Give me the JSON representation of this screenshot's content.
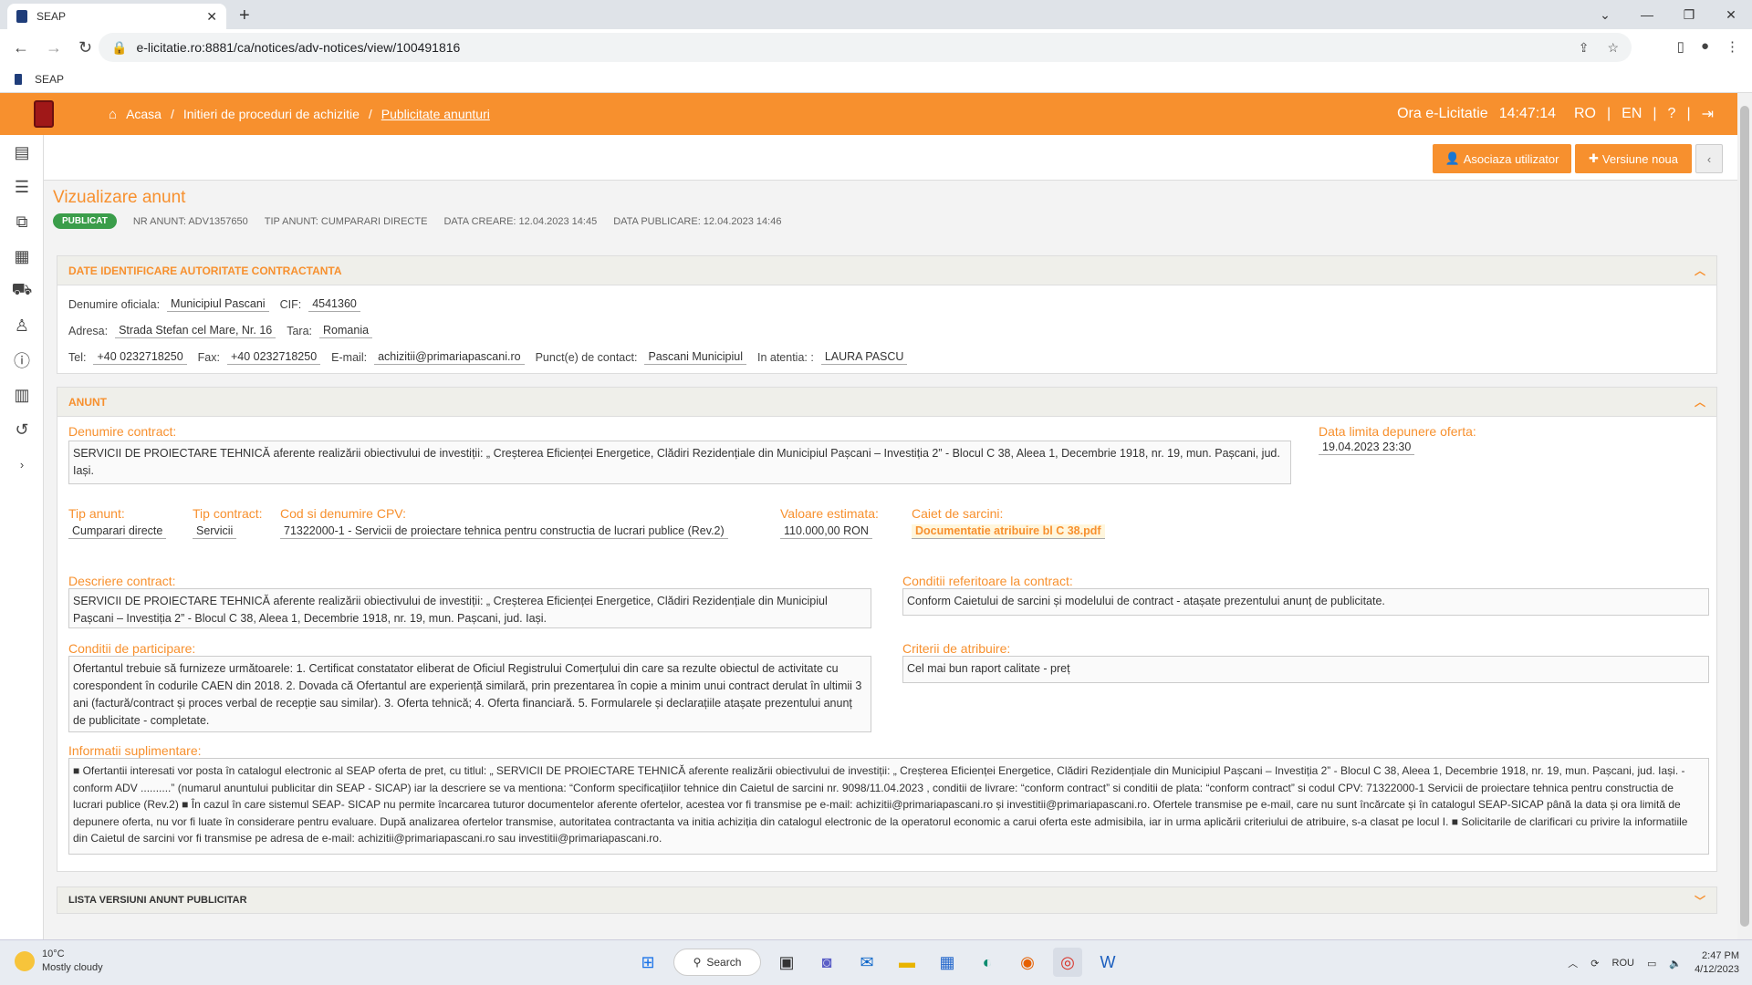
{
  "browser": {
    "tab_title": "SEAP",
    "url": "e-licitatie.ro:8881/ca/notices/adv-notices/view/100491816",
    "bookmark": "SEAP"
  },
  "header": {
    "crumbs": [
      "Acasa",
      "Initieri de proceduri de achizitie",
      "Publicitate anunturi"
    ],
    "time_label": "Ora e-Licitatie",
    "time": "14:47:14",
    "lang_ro": "RO",
    "lang_en": "EN"
  },
  "toolbar": {
    "assoc_label": "Asociaza utilizator",
    "new_version_label": "Versiune noua",
    "collapse_label": "‹"
  },
  "page": {
    "title": "Vizualizare anunt",
    "status": "PUBLICAT",
    "nr_anunt": "NR ANUNT: ADV1357650",
    "tip_anunt": "TIP ANUNT: CUMPARARI DIRECTE",
    "data_creare": "DATA CREARE: 12.04.2023 14:45",
    "data_publicare": "DATA PUBLICARE: 12.04.2023 14:46"
  },
  "authority": {
    "heading": "DATE IDENTIFICARE AUTORITATE CONTRACTANTA",
    "denumire_lbl": "Denumire oficiala:",
    "denumire": "Municipiul Pascani",
    "cif_lbl": "CIF:",
    "cif": "4541360",
    "adresa_lbl": "Adresa:",
    "adresa": "Strada Stefan cel Mare, Nr. 16",
    "tara_lbl": "Tara:",
    "tara": "Romania",
    "tel_lbl": "Tel:",
    "tel": "+40 0232718250",
    "fax_lbl": "Fax:",
    "fax": "+40 0232718250",
    "email_lbl": "E-mail:",
    "email": "achizitii@primariapascani.ro",
    "contact_lbl": "Punct(e) de contact:",
    "contact": "Pascani Municipiul",
    "atentia_lbl": "In atentia: :",
    "atentia": "LAURA PASCU"
  },
  "anunt": {
    "heading": "ANUNT",
    "denumire_lbl": "Denumire contract:",
    "denumire": "SERVICII DE PROIECTARE TEHNICĂ aferente realizării obiectivului de investiții: „ Creșterea Eficienței Energetice, Clădiri Rezidențiale din Municipiul Pașcani – Investiția 2” - Blocul C 38, Aleea 1, Decembrie 1918, nr. 19, mun. Pașcani, jud. Iași.",
    "data_limita_lbl": "Data limita depunere oferta:",
    "data_limita": "19.04.2023 23:30",
    "tip_anunt_lbl": "Tip anunt:",
    "tip_anunt": "Cumparari directe",
    "tip_contract_lbl": "Tip contract:",
    "tip_contract": "Servicii",
    "cpv_lbl": "Cod si denumire CPV:",
    "cpv": "71322000-1 - Servicii de proiectare tehnica pentru constructia de lucrari publice (Rev.2)",
    "valoare_lbl": "Valoare estimata:",
    "valoare": "110.000,00  RON",
    "caiet_lbl": "Caiet de sarcini:",
    "caiet": "Documentatie atribuire bl C 38.pdf",
    "descriere_lbl": "Descriere contract:",
    "descriere": "SERVICII DE PROIECTARE TEHNICĂ aferente realizării obiectivului de investiții: „ Creșterea Eficienței Energetice, Clădiri Rezidențiale din Municipiul Pașcani – Investiția 2” - Blocul C 38, Aleea 1, Decembrie 1918, nr. 19, mun. Pașcani, jud. Iași.",
    "conditii_contract_lbl": "Conditii referitoare la contract:",
    "conditii_contract": "Conform Caietului de sarcini și modelului de contract - atașate prezentului anunț de publicitate.",
    "conditii_part_lbl": "Conditii de participare:",
    "conditii_part": "Ofertantul trebuie să furnizeze următoarele: 1. Certificat constatator eliberat de Oficiul Registrului Comerțului din care sa rezulte obiectul de activitate cu corespondent în codurile CAEN din 2018. 2. Dovada că Ofertantul are experiență similară, prin prezentarea în copie a minim unui contract derulat în ultimii 3 ani (factură/contract și proces verbal de recepție sau similar). 3. Oferta tehnică; 4. Oferta financiară. 5. Formularele și declarațiile atașate prezentului anunț de publicitate - completate.",
    "criterii_lbl": "Criterii de atribuire:",
    "criterii": "Cel mai bun raport calitate - preț",
    "info_lbl": "Informatii suplimentare:",
    "info": "■ Ofertantii interesati vor posta în catalogul electronic al SEAP oferta de pret, cu titlul: „ SERVICII DE PROIECTARE TEHNICĂ aferente realizării obiectivului de investiții: „ Creșterea Eficienței Energetice, Clădiri Rezidențiale din Municipiul Pașcani – Investiția 2” - Blocul C 38, Aleea 1, Decembrie 1918, nr. 19, mun. Pașcani, jud. Iași. - conform ADV ..........” (numarul anuntului publicitar din SEAP - SICAP) iar la descriere se va mentiona: “Conform specificațiilor tehnice din Caietul de sarcini nr. 9098/11.04.2023 , conditii de livrare: “conform contract” si conditii de plata: “conform contract” si codul CPV: 71322000-1 Servicii de proiectare tehnica pentru constructia de lucrari publice (Rev.2) ■ În cazul în care sistemul SEAP- SICAP nu permite încarcarea tuturor documentelor aferente ofertelor, acestea vor fi transmise pe e-mail: achizitii@primariapascani.ro și investitii@primariapascani.ro. Ofertele transmise pe e-mail, care nu sunt încărcate și în catalogul SEAP-SICAP până la data și ora limită de depunere oferta, nu vor fi luate în considerare pentru evaluare. După analizarea ofertelor transmise, autoritatea contractanta va initia achiziția din catalogul electronic de la operatorul economic a carui oferta este admisibila, iar in urma aplicării criteriului de atribuire, s-a clasat pe locul I. ■ Solicitarile de clarificari cu privire la informatiile din Caietul de sarcini vor fi transmise pe adresa de e-mail: achizitii@primariapascani.ro sau investitii@primariapascani.ro."
  },
  "versions": {
    "heading": "LISTA VERSIUNI ANUNT PUBLICITAR"
  },
  "taskbar": {
    "temp": "10°C",
    "weather": "Mostly cloudy",
    "search": "Search",
    "lang": "ROU",
    "time": "2:47 PM",
    "date": "4/12/2023"
  }
}
